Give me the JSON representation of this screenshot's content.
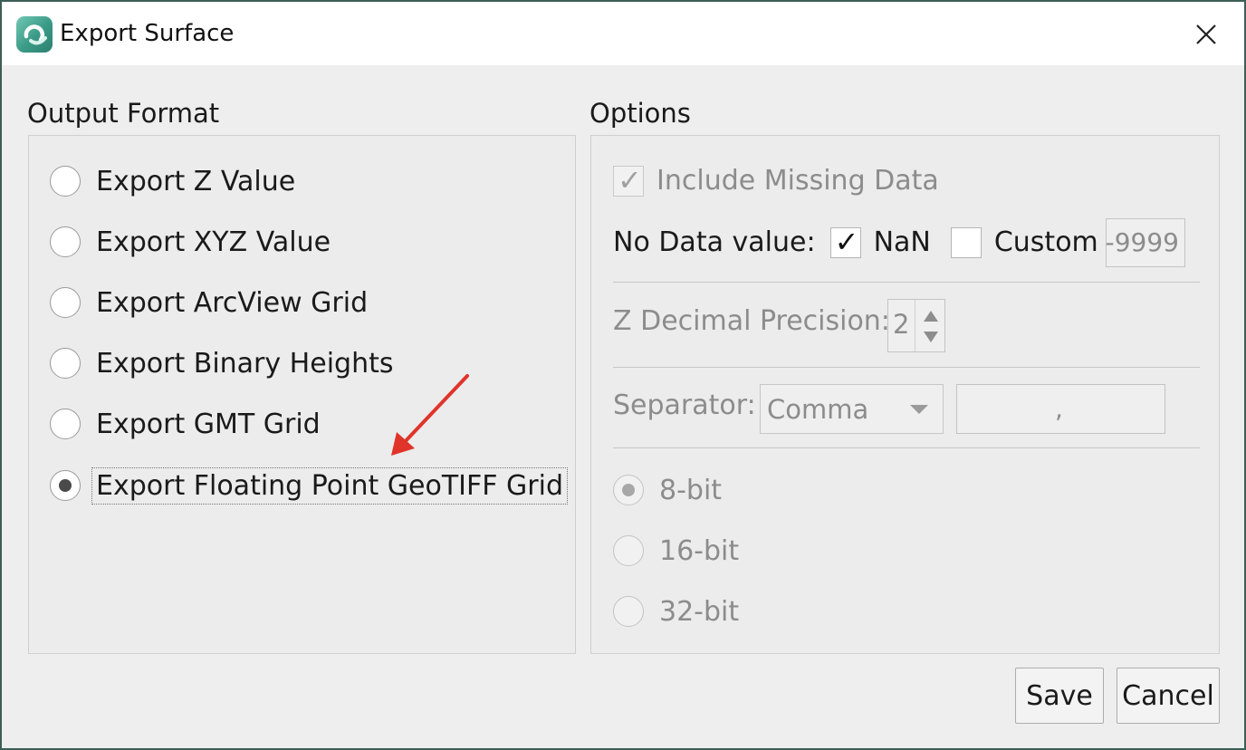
{
  "window": {
    "title": "Export Surface"
  },
  "output_format": {
    "heading": "Output Format",
    "options": [
      {
        "label": "Export Z Value",
        "selected": false
      },
      {
        "label": "Export XYZ Value",
        "selected": false
      },
      {
        "label": "Export ArcView Grid",
        "selected": false
      },
      {
        "label": "Export Binary Heights",
        "selected": false
      },
      {
        "label": "Export GMT Grid",
        "selected": false
      },
      {
        "label": "Export Floating Point GeoTIFF Grid",
        "selected": true
      }
    ]
  },
  "options": {
    "heading": "Options",
    "include_missing_data": {
      "label": "Include Missing Data",
      "checked": true,
      "enabled": false
    },
    "no_data": {
      "label": "No Data value:",
      "nan_label": "NaN",
      "nan_checked": true,
      "custom_label": "Custom",
      "custom_checked": false,
      "custom_value": "-9999"
    },
    "z_precision": {
      "label": "Z Decimal Precision:",
      "value": "2"
    },
    "separator": {
      "label": "Separator:",
      "selected": "Comma",
      "value": ","
    },
    "bit_depth": [
      {
        "label": "8-bit",
        "selected": true
      },
      {
        "label": "16-bit",
        "selected": false
      },
      {
        "label": "32-bit",
        "selected": false
      }
    ]
  },
  "buttons": {
    "save": "Save",
    "cancel": "Cancel"
  },
  "annotation": {
    "arrow_color": "#e0342a"
  }
}
